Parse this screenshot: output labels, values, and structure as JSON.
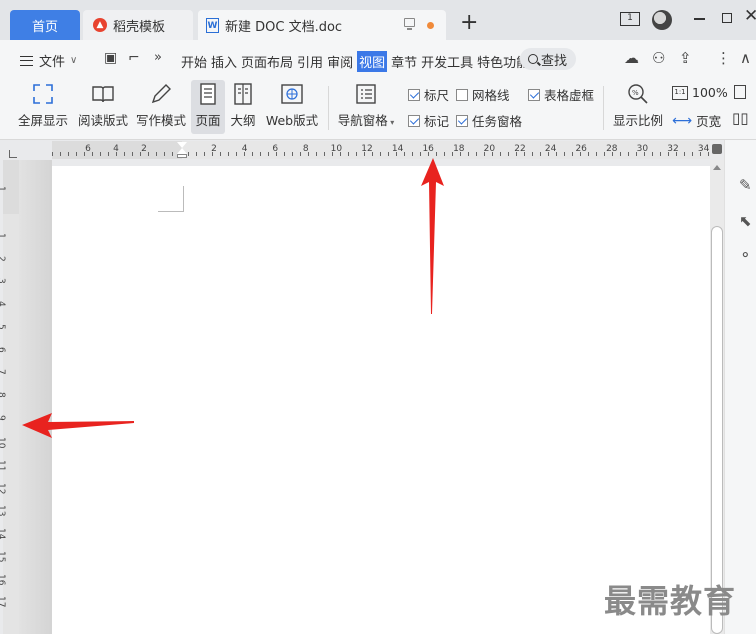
{
  "tabs": {
    "home": "首页",
    "template": "稻壳模板",
    "document": "新建 DOC 文档.doc",
    "new_tab": "+"
  },
  "window": {
    "badge": "1"
  },
  "menubar": {
    "file": "文件",
    "items": [
      "开始",
      "插入",
      "页面布局",
      "引用",
      "审阅",
      "视图",
      "章节",
      "开发工具",
      "特色功能"
    ],
    "active": "视图",
    "search": "查找"
  },
  "ribbon": {
    "fullscreen": "全屏显示",
    "read_mode": "阅读版式",
    "write_mode": "写作模式",
    "page": "页面",
    "outline": "大纲",
    "web_layout": "Web版式",
    "nav_pane": "导航窗格",
    "ruler": "标尺",
    "gridlines": "网格线",
    "table_gridlines": "表格虚框",
    "marks": "标记",
    "task_pane": "任务窗格",
    "zoom": "显示比例",
    "zoom_100": "100%",
    "page_width": "页宽",
    "checkboxes": {
      "ruler": true,
      "gridlines": false,
      "table_gridlines": true,
      "marks": true,
      "task_pane": true
    }
  },
  "hruler_labels": [
    "6",
    "4",
    "2",
    "2",
    "4",
    "6",
    "8",
    "10",
    "12",
    "14",
    "16",
    "18",
    "20",
    "22",
    "24",
    "26",
    "28",
    "30",
    "32",
    "34"
  ],
  "vruler_labels": [
    "1",
    "1",
    "2",
    "3",
    "4",
    "5",
    "6",
    "7",
    "8",
    "9",
    "10",
    "11",
    "12",
    "13",
    "14",
    "15",
    "16",
    "17"
  ],
  "watermark": "最需教育",
  "colors": {
    "accent": "#3f7fe5",
    "arrow": "#e8231f"
  }
}
